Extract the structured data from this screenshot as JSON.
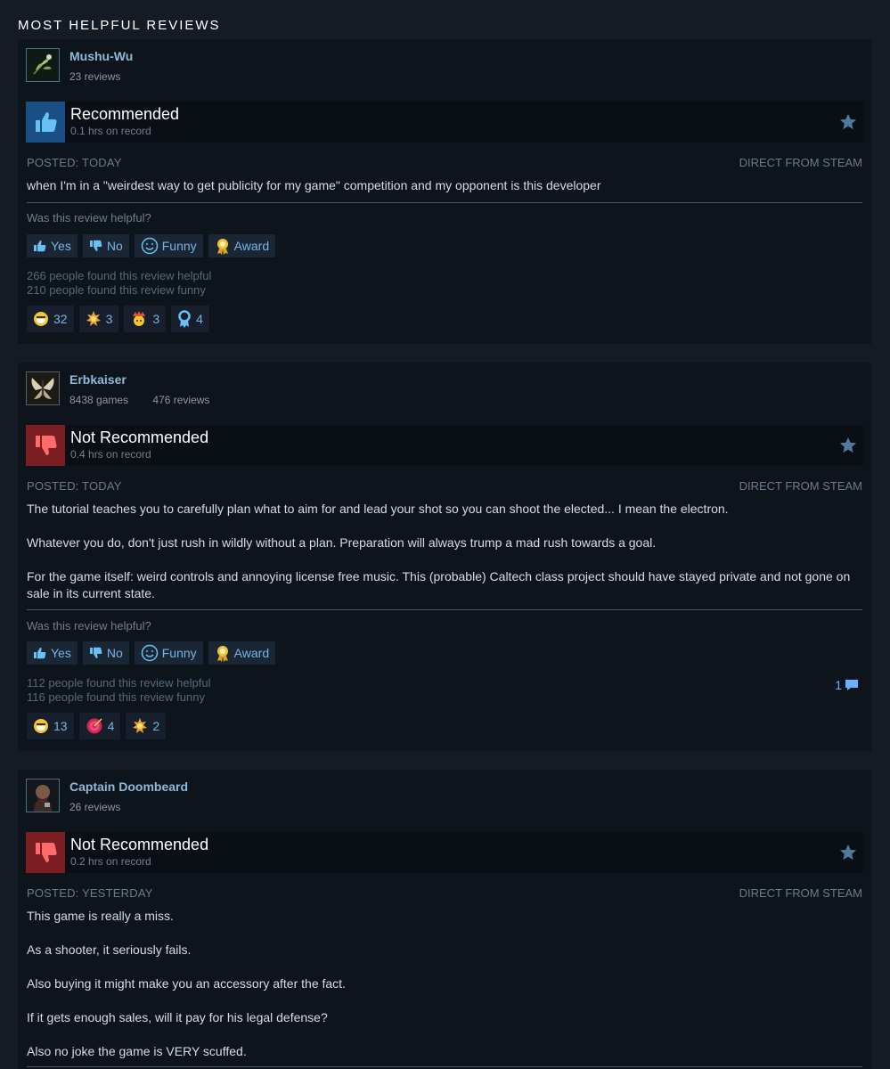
{
  "section_title": "MOST HELPFUL REVIEWS",
  "reviews": [
    {
      "author": "Mushu-Wu",
      "reviews_count": "23 reviews",
      "verdict": "Recommended",
      "hours": "0.1 hrs on record",
      "posted": "POSTED: TODAY",
      "source": "DIRECT FROM STEAM",
      "body": [
        "when I'm in a \"weirdest way to get publicity for my game\" competition and my opponent is this developer"
      ],
      "helpful_question": "Was this review helpful?",
      "buttons": {
        "yes": "Yes",
        "no": "No",
        "funny": "Funny",
        "award": "Award"
      },
      "helpful_stat": "266 people found this review helpful",
      "funny_stat": "210 people found this review funny",
      "awards": [
        "32",
        "3",
        "3",
        "4"
      ]
    },
    {
      "author": "Erbkaiser",
      "games_count": "8438 games",
      "reviews_count": "476 reviews",
      "verdict": "Not Recommended",
      "hours": "0.4 hrs on record",
      "posted": "POSTED: TODAY",
      "source": "DIRECT FROM STEAM",
      "body": [
        "The tutorial teaches you to carefully plan what to aim for and lead your shot so you can shoot the elected... I mean the electron.",
        "Whatever you do, don't just rush in wildly without a plan. Preparation will always trump a mad rush towards a goal.",
        "For the game itself: weird controls and annoying license free music. This (probable) Caltech class project should have stayed private and not gone on sale in its current state."
      ],
      "helpful_question": "Was this review helpful?",
      "buttons": {
        "yes": "Yes",
        "no": "No",
        "funny": "Funny",
        "award": "Award"
      },
      "helpful_stat": "112 people found this review helpful",
      "funny_stat": "116 people found this review funny",
      "comments": "1",
      "awards": [
        "13",
        "4",
        "2"
      ]
    },
    {
      "author": "Captain Doombeard",
      "reviews_count": "26 reviews",
      "verdict": "Not Recommended",
      "hours": "0.2 hrs on record",
      "posted": "POSTED: YESTERDAY",
      "source": "DIRECT FROM STEAM",
      "body": [
        "This game is really a miss.",
        "As a shooter, it seriously fails.",
        "Also buying it might make you an accessory after the fact.",
        "If it gets enough sales, will it pay for his legal defense?",
        "Also no joke the game is VERY scuffed."
      ]
    }
  ]
}
